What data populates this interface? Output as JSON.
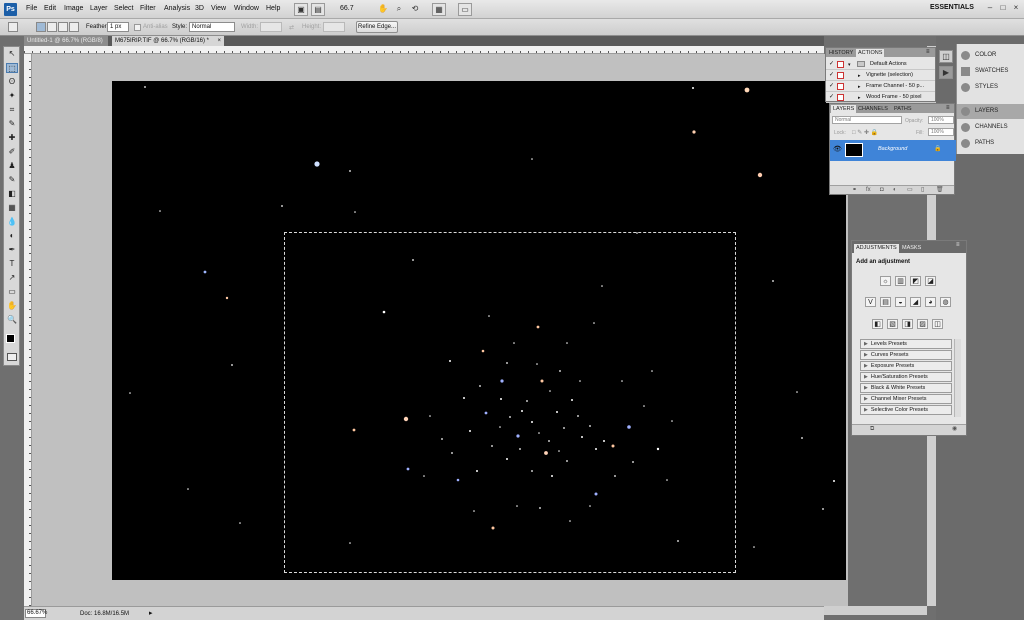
{
  "app": {
    "logo": "Ps"
  },
  "menu": {
    "items": [
      "File",
      "Edit",
      "Image",
      "Layer",
      "Select",
      "Filter",
      "Analysis",
      "3D",
      "View",
      "Window",
      "Help"
    ]
  },
  "menubar": {
    "zoom_readout": "66.7",
    "workspace_label": "ESSENTIALS",
    "icons": [
      "bridge-icon",
      "zoom-dropdown",
      "hand-icon",
      "zoom-tool-icon",
      "rotate-icon",
      "arrange-icon",
      "screen-mode-icon"
    ]
  },
  "window_buttons": {
    "minimize": "–",
    "restore": "□",
    "close": "×"
  },
  "options": {
    "feather_label": "Feather:",
    "feather_value": "1 px",
    "antialias_label": "Anti-alias",
    "style_label": "Style:",
    "style_value": "Normal",
    "width_label": "Width:",
    "height_label": "Height:",
    "refine_edge_label": "Refine Edge..."
  },
  "tabs": [
    {
      "label": "Untitled-1 @ 66.7% (RGB/8)",
      "active": false,
      "close": "×"
    },
    {
      "label": "M675IRIP.TIF @ 66.7% (RGB/16) *",
      "active": true,
      "close": "×"
    }
  ],
  "tools": [
    "↖",
    "⬚",
    "ʘ",
    "✦",
    "⌗",
    "✎",
    "✚",
    "✐",
    "♟",
    "✎",
    "◧",
    "▦",
    "💧",
    "◐",
    "✒",
    "T",
    "↗",
    "▭",
    "✋",
    "🔍",
    "■"
  ],
  "status": {
    "zoom": "66.67%",
    "doc_size": "Doc: 16.8M/16.5M"
  },
  "dock": {
    "items": [
      {
        "label": "COLOR",
        "icon": "color-icon",
        "selected": false
      },
      {
        "label": "SWATCHES",
        "icon": "swatches-icon",
        "selected": false
      },
      {
        "label": "STYLES",
        "icon": "styles-icon",
        "selected": false
      },
      {
        "label": "LAYERS",
        "icon": "layers-icon",
        "selected": true
      },
      {
        "label": "CHANNELS",
        "icon": "channels-icon",
        "selected": false
      },
      {
        "label": "PATHS",
        "icon": "paths-icon",
        "selected": false
      }
    ]
  },
  "actions_panel": {
    "tabs": [
      "HISTORY",
      "ACTIONS"
    ],
    "active_tab": "ACTIONS",
    "rows": [
      {
        "label": "Default Actions",
        "checked": "✓",
        "folder": true
      },
      {
        "label": "Vignette (selection)",
        "checked": "✓",
        "folder": false
      },
      {
        "label": "Frame Channel - 50 p...",
        "checked": "✓",
        "folder": false
      },
      {
        "label": "Wood Frame - 50 pixel",
        "checked": "✓",
        "folder": false
      }
    ]
  },
  "layers_panel": {
    "tabs": [
      "LAYERS",
      "CHANNELS",
      "PATHS"
    ],
    "active_tab": "LAYERS",
    "blend_mode": "Normal",
    "opacity_label": "Opacity:",
    "opacity_value": "100%",
    "lock_label": "Lock:",
    "fill_label": "Fill:",
    "fill_value": "100%",
    "layer_name": "Background",
    "lock_glyph": "🔒",
    "eye_glyph": "👁"
  },
  "adjustments_panel": {
    "tabs": [
      "ADJUSTMENTS",
      "MASKS"
    ],
    "active_tab": "ADJUSTMENTS",
    "title": "Add an adjustment",
    "icon_rows": [
      [
        "☼",
        "▥",
        "◩",
        "◪"
      ],
      [
        "V",
        "▤",
        "◒",
        "◢",
        "◕",
        "◍"
      ],
      [
        "◧",
        "▧",
        "◨",
        "▨",
        "◫"
      ]
    ],
    "presets": [
      "Levels Presets",
      "Curves Presets",
      "Exposure Presets",
      "Hue/Saturation Presets",
      "Black & White Presets",
      "Channel Mixer Presets",
      "Selective Color Presets"
    ]
  },
  "colors": {
    "accent": "#3f84d8",
    "canvas": "#000000",
    "pasteboard": "#c0c0c0"
  }
}
